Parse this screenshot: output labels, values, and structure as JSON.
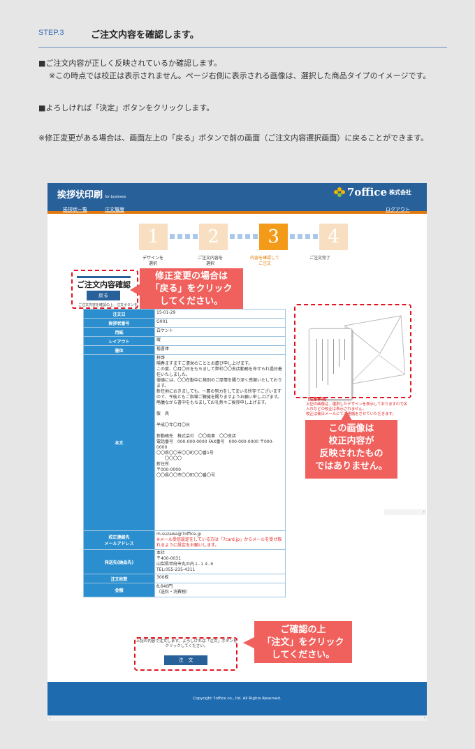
{
  "instructions": {
    "step_label": "STEP.3",
    "step_title": "ご注文内容を確認します。",
    "line1": "■ご注文内容が正しく反映されているか確認します。",
    "line2": "※この時点では校正は表示されません。ページ右側に表示される画像は、選択した商品タイプのイメージです。",
    "line3": "■よろしければ「決定」ボタンをクリックします。",
    "line4": "※修正変更がある場合は、画面左上の「戻る」ボタンで前の画面（ご注文内容選択画面）に戻ることができます。"
  },
  "screen": {
    "brand": "挨拶状印刷",
    "brand_sub": "for business",
    "logo_text": "7office",
    "logo_corp": "株式会社",
    "nav": {
      "list": "挨拶状一覧",
      "history": "注文履歴",
      "logout": "ログアウト"
    },
    "steps": [
      {
        "num": "1",
        "caption": "デザインを\n選択",
        "active": false
      },
      {
        "num": "2",
        "caption": "ご注文内容を\n選択",
        "active": false
      },
      {
        "num": "3",
        "caption": "内容を確認して\nご注文",
        "active": true
      },
      {
        "num": "4",
        "caption": "ご注文完了",
        "active": false
      }
    ],
    "page_title": "ご注文内容確認",
    "back_button": "戻る",
    "back_note": "ご注文内容を確認の上、注文ボタンを",
    "table": {
      "order_date_label": "注文日",
      "order_date": "15-01-29",
      "card_no_label": "挨拶状番号",
      "card_no": "G001",
      "paper_label": "用紙",
      "paper": "白ケント",
      "layout_label": "レイアウト",
      "layout": "縦",
      "font_label": "書体",
      "font": "楷書体",
      "body_label": "本文",
      "body": "拝啓\n陽春ますますご清栄のこととお慶び申し上げます。\nこの度、〇月〇日をもちまして弊社〇〇支店勤務を命ぜられ過日着任いたしました。\n値値には、〇〇在勤中に格別のご厚情を賜り深く感謝いたしております。\n新任地におきましても、一層の努力をしてまいる所存でございますので、今後ともご指導ご鞭撻を賜りますようお願い申し上げます。\n略儀ながら書中をもちましてお礼旁々ご挨拶申し上げます。\n\n敬　具\n\n平成〇年〇月〇日\n\n新勤務先　株式会社　〇〇商事　〇〇支店\n電話番号　000-000-0000 FAX番号　000-000-0000 〒000-0000\n〇〇県〇〇市〇〇町〇〇番1号\n　　〇〇〇〇\n新住所\n〒000-0000\n〇〇県〇〇市〇〇町〇〇番〇号",
      "email_label": "校正連絡先\nメールアドレス",
      "email": "m-suzawa@7office.jp",
      "email_note": "※メール受信設定をしている方は「7card.jp」からメールを受け取れるように設定をお願いします。",
      "ship_label": "発送先(納品先)",
      "ship": "本社\n〒400-0031\n山梨県甲府市丸の内１-１４-６\nTEL:055-235-4311",
      "qty_label": "注文枚数",
      "qty": "300枚",
      "amount_label": "金額",
      "amount": "8,640円\n（送料・消費税）"
    },
    "preview_warn_title": "【注意事項】",
    "preview_warn": "上記の画像は、選択したデザインを表示しておりますので名入れなどの校正は表示されません。\n校正は後日メールにてご連絡をさせていただきます。",
    "confirm_text": "上記の内容で注文します。よろしければ「注文」ボタンをクリックしてください。",
    "order_button": "注　文",
    "footer": "Copyright 7office co., ltd. All Rights Reserved."
  },
  "callouts": {
    "back": "修正変更の場合は\n「戻る」をクリック\nしてください。",
    "image": "この画像は\n校正内容が\n反映されたもの\nではありません。",
    "order": "ご確認の上\n「注文」をクリック\nしてください。"
  },
  "colors": {
    "accent_blue": "#28609a",
    "accent_orange": "#f39a18",
    "callout_red": "#f0605c"
  }
}
